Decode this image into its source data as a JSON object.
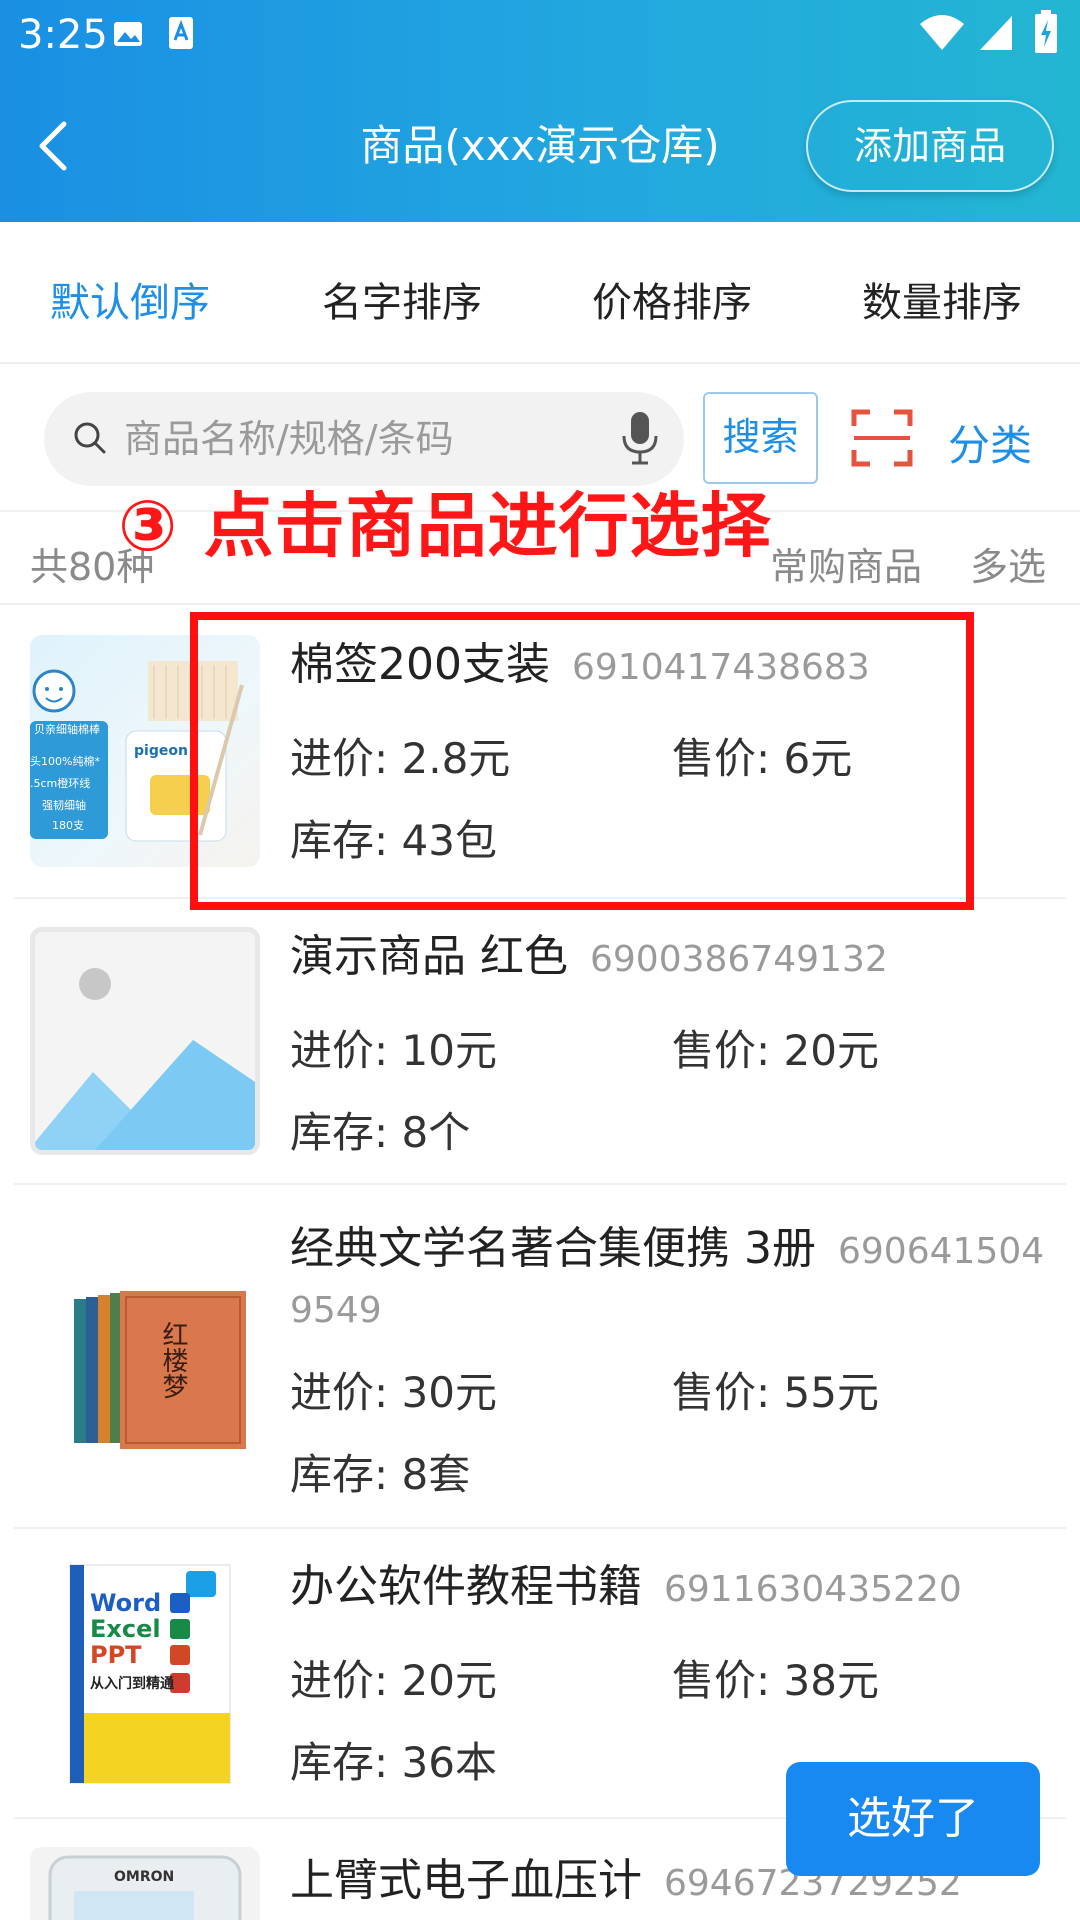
{
  "status_bar": {
    "time": "3:25"
  },
  "header": {
    "title": "商品(xxx演示仓库)",
    "add_button": "添加商品"
  },
  "tabs": [
    {
      "label": "默认倒序",
      "active": true
    },
    {
      "label": "名字排序",
      "active": false
    },
    {
      "label": "价格排序",
      "active": false
    },
    {
      "label": "数量排序",
      "active": false
    }
  ],
  "search": {
    "placeholder": "商品名称/规格/条码",
    "button": "搜索",
    "category": "分类"
  },
  "summary": {
    "total": "共80种",
    "frequent": "常购商品",
    "multi_select": "多选"
  },
  "annotation": "③ 点击商品进行选择",
  "products": [
    {
      "name": "棉签200支装",
      "barcode": "6910417438683",
      "cost": "进价: 2.8元",
      "price": "售价: 6元",
      "stock": "库存: 43包"
    },
    {
      "name": "演示商品 红色",
      "barcode": "6900386749132",
      "cost": "进价: 10元",
      "price": "售价: 20元",
      "stock": "库存: 8个"
    },
    {
      "name": "经典文学名著合集便携 3册",
      "barcode": "6906415049549",
      "cost": "进价: 30元",
      "price": "售价: 55元",
      "stock": "库存: 8套"
    },
    {
      "name": "办公软件教程书籍",
      "barcode": "6911630435220",
      "cost": "进价: 20元",
      "price": "售价: 38元",
      "stock": "库存: 36本"
    },
    {
      "name": "上臂式电子血压计",
      "barcode": "6946723729252"
    }
  ],
  "thumb_text": {
    "cotton_badge": "贝亲细轴棉棒",
    "cotton_line1": "头100%纯棉*",
    "cotton_line2": ".5cm橙环线",
    "cotton_line3": "强韧细轴",
    "cotton_line4": "180支",
    "cotton_brand": "pigeon",
    "book_title": "红楼梦",
    "office_w": "Word",
    "office_e": "Excel",
    "office_p": "PPT",
    "office_sub": "从入门到精通",
    "omron": "OMRON"
  },
  "done_button": "选好了",
  "colors": {
    "accent": "#1f8ee6",
    "header_start": "#1a8fe3",
    "header_end": "#23b6d2",
    "highlight": "#ff1010",
    "done": "#1789f0"
  }
}
